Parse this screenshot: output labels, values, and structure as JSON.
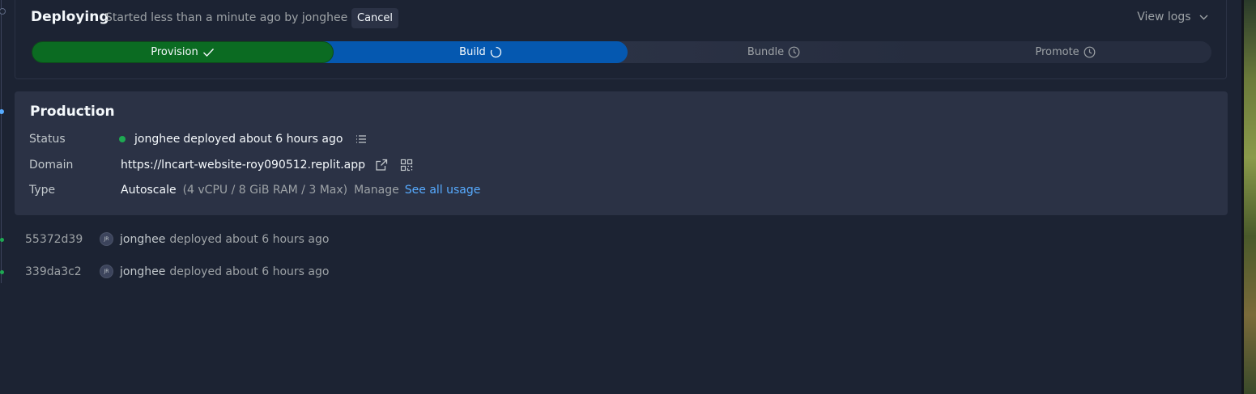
{
  "deploy": {
    "title": "Deploying",
    "subtitle": "Started less than a minute ago by jonghee",
    "cancel_label": "Cancel",
    "view_logs_label": "View logs",
    "steps": [
      {
        "label": "Provision",
        "state": "done",
        "icon": "check-icon"
      },
      {
        "label": "Build",
        "state": "in-progress",
        "icon": "spinner-icon"
      },
      {
        "label": "Bundle",
        "state": "pending",
        "icon": "clock-icon"
      },
      {
        "label": "Promote",
        "state": "pending",
        "icon": "clock-icon"
      }
    ]
  },
  "production": {
    "title": "Production",
    "status_label": "Status",
    "status_user": "jonghee",
    "status_text": "deployed about 6 hours ago",
    "domain_label": "Domain",
    "domain_url": "https://lncart-website-roy090512.replit.app",
    "type_label": "Type",
    "type_value": "Autoscale",
    "type_detail": "(4 vCPU / 8 GiB RAM / 3 Max)",
    "manage_label": "Manage",
    "usage_link": "See all usage"
  },
  "history": [
    {
      "hash": "55372d39",
      "avatar": "JR",
      "user": "jonghee",
      "text": "deployed about 6 hours ago"
    },
    {
      "hash": "339da3c2",
      "avatar": "JR",
      "user": "jonghee",
      "text": "deployed about 6 hours ago"
    }
  ],
  "colors": {
    "background": "#1c2333",
    "card": "#2b3245",
    "success": "#0b6b22",
    "progress_blue": "#0558b0",
    "link": "#57abff",
    "status_green": "#1ea952"
  }
}
